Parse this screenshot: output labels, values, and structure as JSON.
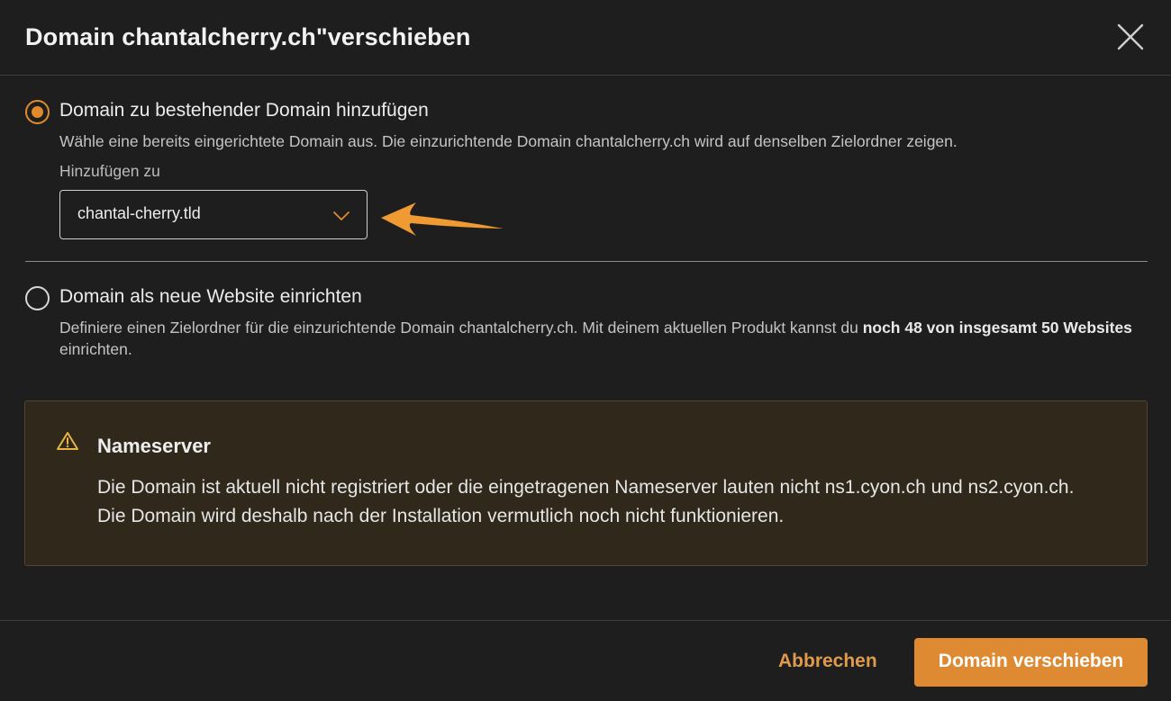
{
  "dialog": {
    "title": "Domain chantalcherry.ch\"verschieben"
  },
  "option_add": {
    "label": "Domain zu bestehender Domain hinzufügen",
    "description": "Wähle eine bereits eingerichtete Domain aus. Die einzurichtende Domain chantalcherry.ch wird auf denselben Zielordner zeigen.",
    "selected": true,
    "add_to_label": "Hinzufügen zu",
    "select_value": "chantal-cherry.tld"
  },
  "option_new": {
    "label": "Domain als neue Website einrichten",
    "description_start": "Definiere einen Zielordner für die einzurichtende Domain chantalcherry.ch. Mit deinem aktuellen Produkt kannst du ",
    "description_bold": "noch 48 von insgesamt 50 Websites",
    "description_end": " einrichten.",
    "selected": false
  },
  "warning": {
    "title": "Nameserver",
    "body": "Die Domain ist aktuell nicht registriert oder die eingetragenen Nameserver lauten nicht ns1.cyon.ch und ns2.cyon.ch. Die Domain wird deshalb nach der Installation vermutlich noch nicht funktionieren."
  },
  "footer": {
    "cancel_label": "Abbrechen",
    "submit_label": "Domain verschieben"
  },
  "icons": {
    "close": "close-icon",
    "chevron": "chevron-down-icon",
    "warning": "warning-triangle-icon",
    "annotation": "arrow-left-icon"
  },
  "colors": {
    "accent": "#dd8a33",
    "background": "#1e1e1f",
    "warning_background": "#2f281b"
  }
}
